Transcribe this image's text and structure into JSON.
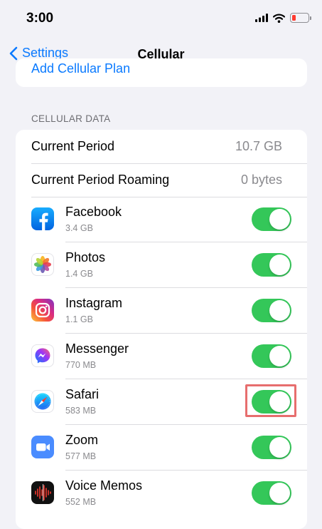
{
  "status_bar": {
    "time": "3:00",
    "battery_color": "#ff3b30"
  },
  "nav": {
    "back_label": "Settings",
    "title": "Cellular"
  },
  "top_card": {
    "partial_item_label": "Add Cellular Plan"
  },
  "section": {
    "header": "CELLULAR DATA"
  },
  "summary_rows": [
    {
      "label": "Current Period",
      "value": "10.7 GB"
    },
    {
      "label": "Current Period Roaming",
      "value": "0 bytes"
    }
  ],
  "apps": [
    {
      "name": "Facebook",
      "usage": "3.4 GB",
      "icon": "facebook-icon",
      "enabled": true
    },
    {
      "name": "Photos",
      "usage": "1.4 GB",
      "icon": "photos-icon",
      "enabled": true
    },
    {
      "name": "Instagram",
      "usage": "1.1 GB",
      "icon": "instagram-icon",
      "enabled": true
    },
    {
      "name": "Messenger",
      "usage": "770 MB",
      "icon": "messenger-icon",
      "enabled": true
    },
    {
      "name": "Safari",
      "usage": "583 MB",
      "icon": "safari-icon",
      "enabled": true,
      "highlighted": true
    },
    {
      "name": "Zoom",
      "usage": "577 MB",
      "icon": "zoom-icon",
      "enabled": true
    },
    {
      "name": "Voice Memos",
      "usage": "552 MB",
      "icon": "voice-memos-icon",
      "enabled": true
    }
  ],
  "colors": {
    "accent": "#0a7aff",
    "toggle_on": "#34c759",
    "highlight_box": "#e76e6e",
    "background": "#f2f2f7"
  }
}
